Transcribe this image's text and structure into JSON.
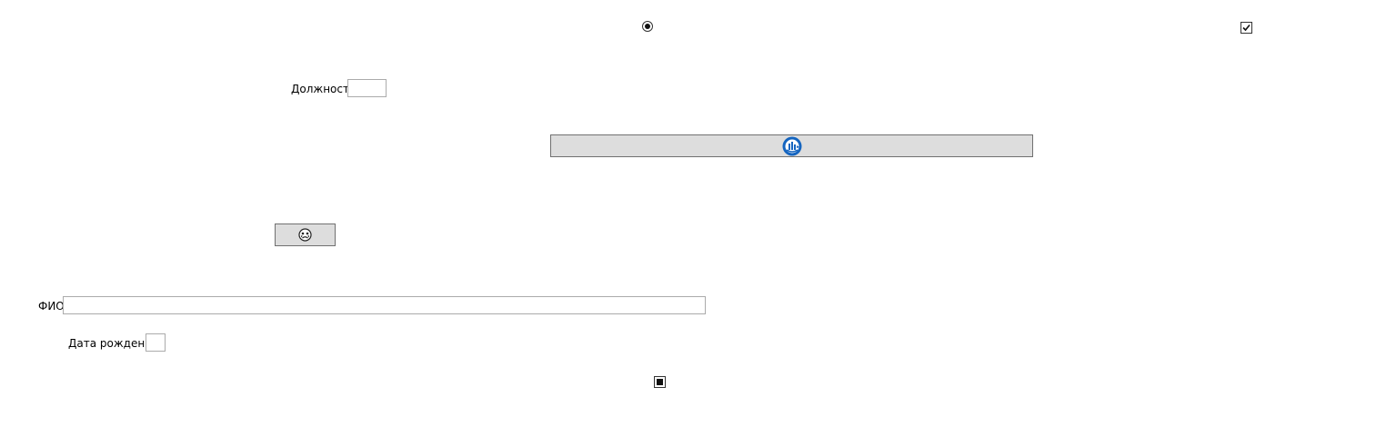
{
  "form": {
    "position_label": "Должность",
    "position_value": "",
    "fio_label": "ФИО",
    "fio_value": "",
    "birthdate_label": "Дата рождения",
    "birthdate_value": "",
    "radio_selected": true,
    "checkbox_checked": true,
    "square_checkbox_state": "indeterminate"
  },
  "buttons": {
    "wide_button_icon": "globe-emblem-icon",
    "small_button_icon": "crying-face-icon"
  },
  "colors": {
    "button_bg": "#dddddd",
    "button_border": "#707070",
    "input_border": "#ababab",
    "emblem_blue": "#1565c0"
  }
}
